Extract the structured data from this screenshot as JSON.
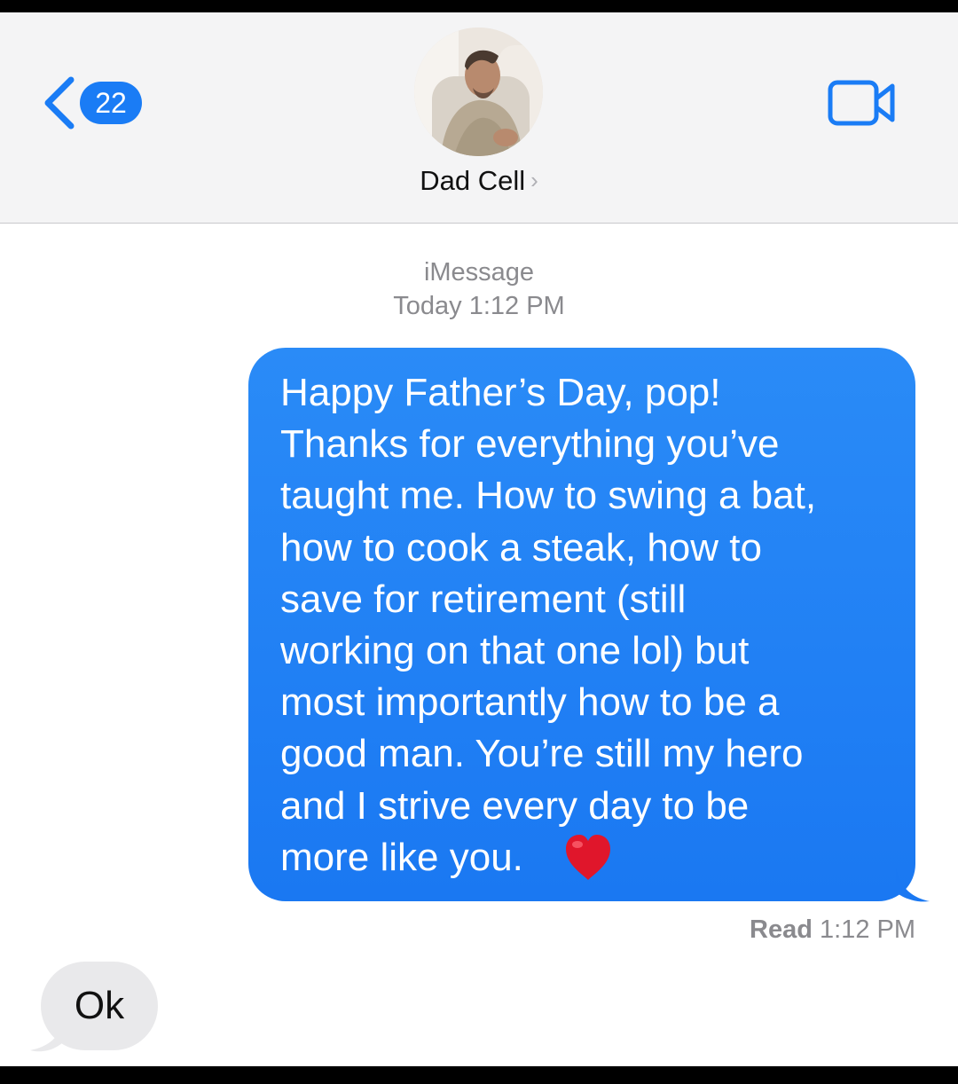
{
  "header": {
    "back_badge": "22",
    "contact_name": "Dad Cell",
    "contact_chevron": "›"
  },
  "conversation": {
    "service": "iMessage",
    "timestamp": "Today 1:12 PM",
    "sent_message": "Happy Father’s Day, pop!\nThanks for everything you’ve\ntaught me. How to swing a bat,\nhow to cook a steak, how to\nsave for retirement (still\nworking on that one lol) but\nmost importantly how to be a\ngood man. You’re still my hero\nand I strive every day to be\nmore like you.",
    "sent_emoji": "heart-icon",
    "read_label": "Read",
    "read_time": "1:12 PM",
    "received_message": "Ok"
  },
  "colors": {
    "accent": "#1a7cf5",
    "sent_bubble": "#1a78f2",
    "received_bubble": "#e9e9eb",
    "heart": "#e0162b"
  }
}
